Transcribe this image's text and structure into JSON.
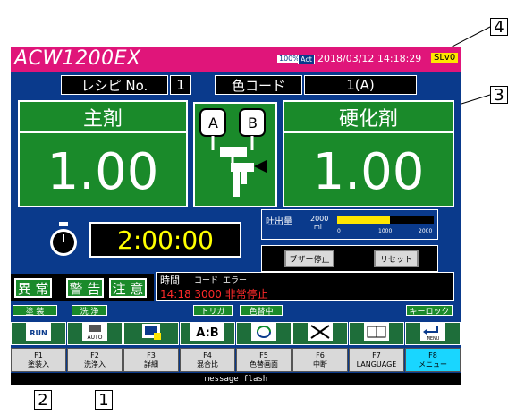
{
  "header": {
    "title": "ACW1200EX",
    "pct_badge": "100%",
    "act_badge": "Act",
    "datetime": "2018/03/12 14:18:29",
    "level_badge": "SLv0"
  },
  "recipe": {
    "label": "レシピ No.",
    "value": "1",
    "color_label": "色コード",
    "color_value": "1(A)"
  },
  "main_agent": {
    "label": "主剤",
    "value": "1.00"
  },
  "hardener": {
    "label": "硬化剤",
    "value": "1.00"
  },
  "mixer_labels": {
    "a": "A",
    "b": "B"
  },
  "timer": {
    "value": "2:00:00"
  },
  "flow": {
    "label": "吐出量",
    "unit": "ml",
    "max": "2000",
    "tick_0": "0",
    "tick_1000": "1000",
    "tick_2000": "2000",
    "fill_fraction": 0.55
  },
  "controls": {
    "buzzer_stop": "ブザー停止",
    "reset": "リセット"
  },
  "alarms": {
    "abnormal": "異 常",
    "warning": "警 告",
    "caution": "注 意"
  },
  "log": {
    "col_time": "時間",
    "col_code": "コード",
    "col_error": "エラー",
    "entry": "14:18 3000 非常停止"
  },
  "status_bar": {
    "painting": "塗 装",
    "cleaning": "洗 浄",
    "trigger": "トリガ",
    "color_change": "色替中",
    "key_lock": "キーロック"
  },
  "icons": [
    {
      "name": "run-icon",
      "text": "RUN"
    },
    {
      "name": "auto-icon",
      "text": "AUTO"
    },
    {
      "name": "detail-icon",
      "text": ""
    },
    {
      "name": "ab-mix-icon",
      "text": "A:B"
    },
    {
      "name": "color-cycle-icon",
      "text": ""
    },
    {
      "name": "stop-cross-icon",
      "text": ""
    },
    {
      "name": "book-icon",
      "text": ""
    },
    {
      "name": "menu-icon",
      "text": "MENU"
    }
  ],
  "fkeys": [
    {
      "key": "F1",
      "label": "塗装入"
    },
    {
      "key": "F2",
      "label": "洗浄入"
    },
    {
      "key": "F3",
      "label": "詳細"
    },
    {
      "key": "F4",
      "label": "混合比"
    },
    {
      "key": "F5",
      "label": "色替画面"
    },
    {
      "key": "F6",
      "label": "中断"
    },
    {
      "key": "F7",
      "label": "LANGUAGE"
    },
    {
      "key": "F8",
      "label": "メニュー"
    }
  ],
  "message": "message flash",
  "callouts": {
    "c1": "1",
    "c2": "2",
    "c3": "3",
    "c4": "4"
  },
  "colors": {
    "bg": "#0a3a8c",
    "title": "#e0157a",
    "green": "#1a8a2a",
    "alarm": "#ff2a2a",
    "gauge": "#ffe600",
    "active_fkey": "#19d6ff"
  }
}
